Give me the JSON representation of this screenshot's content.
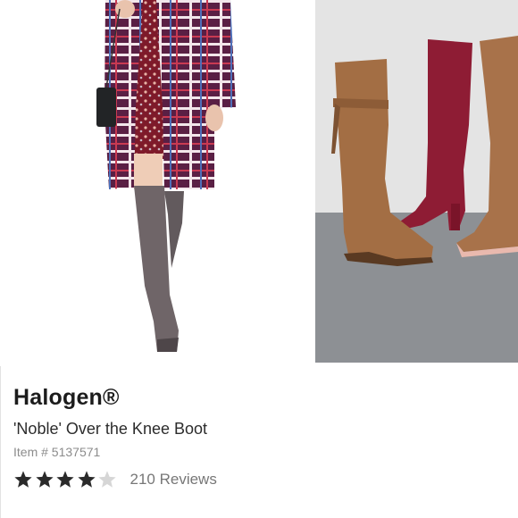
{
  "product": {
    "brand": "Halogen®",
    "name": "'Noble' Over the Knee Boot",
    "item_number": "Item # 5137571",
    "rating": 4,
    "rating_max": 5,
    "reviews_label": "210 Reviews"
  },
  "gallery": {
    "images": [
      {
        "name": "model-wearing-grey-boots-photo"
      },
      {
        "name": "three-boots-product-photo"
      }
    ]
  },
  "colors": {
    "text_primary": "#1c1c1c",
    "text_secondary": "#8c8c8c",
    "star_filled": "#2a2a2a",
    "star_empty": "#d6d6d6"
  }
}
